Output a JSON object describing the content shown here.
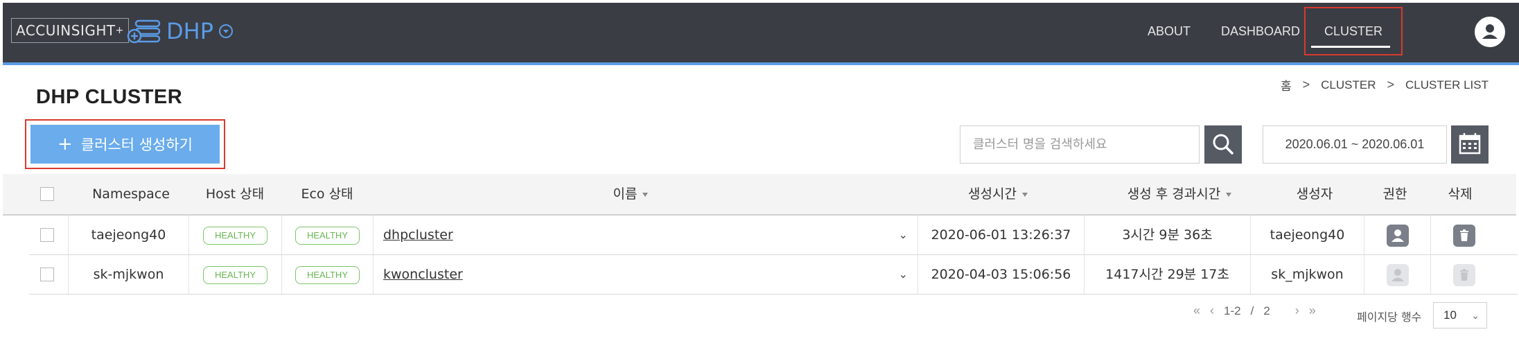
{
  "brand": {
    "name": "ACCUINSIGHT",
    "plus": "+",
    "product": "DHP"
  },
  "nav": {
    "items": [
      "ABOUT",
      "DASHBOARD",
      "CLUSTER"
    ],
    "active": "CLUSTER"
  },
  "page": {
    "title": "DHP CLUSTER"
  },
  "breadcrumb": {
    "items": [
      "홈",
      "CLUSTER",
      "CLUSTER LIST"
    ],
    "separator": ">"
  },
  "toolbar": {
    "create_label": "클러스터 생성하기",
    "search_placeholder": "클러스터 명을 검색하세요",
    "date_range": "2020.06.01 ~ 2020.06.01"
  },
  "table": {
    "columns": {
      "namespace": "Namespace",
      "host_status": "Host 상태",
      "eco_status": "Eco 상태",
      "name": "이름",
      "created": "생성시간",
      "elapsed": "생성 후 경과시간",
      "creator": "생성자",
      "permission": "권한",
      "delete": "삭제"
    },
    "rows": [
      {
        "namespace": "taejeong40",
        "host_status": "HEALTHY",
        "eco_status": "HEALTHY",
        "name": "dhpcluster",
        "created": "2020-06-01 13:26:37",
        "elapsed": "3시간 9분 36초",
        "creator": "taejeong40"
      },
      {
        "namespace": "sk-mjkwon",
        "host_status": "HEALTHY",
        "eco_status": "HEALTHY",
        "name": "kwoncluster",
        "created": "2020-04-03 15:06:56",
        "elapsed": "1417시간 29분 17초",
        "creator": "sk_mjkwon"
      }
    ]
  },
  "pagination": {
    "first": "«",
    "prev": "‹",
    "next": "›",
    "last": "»",
    "range": "1-2",
    "slash": "/",
    "total": "2",
    "per_page_label": "페이지당 행수",
    "per_page": "10"
  },
  "colors": {
    "topbar": "#3a3d44",
    "accent": "#5b9be6",
    "create_button": "#6aacec",
    "highlight_outline": "#d93a2e",
    "healthy": "#6ab654"
  }
}
